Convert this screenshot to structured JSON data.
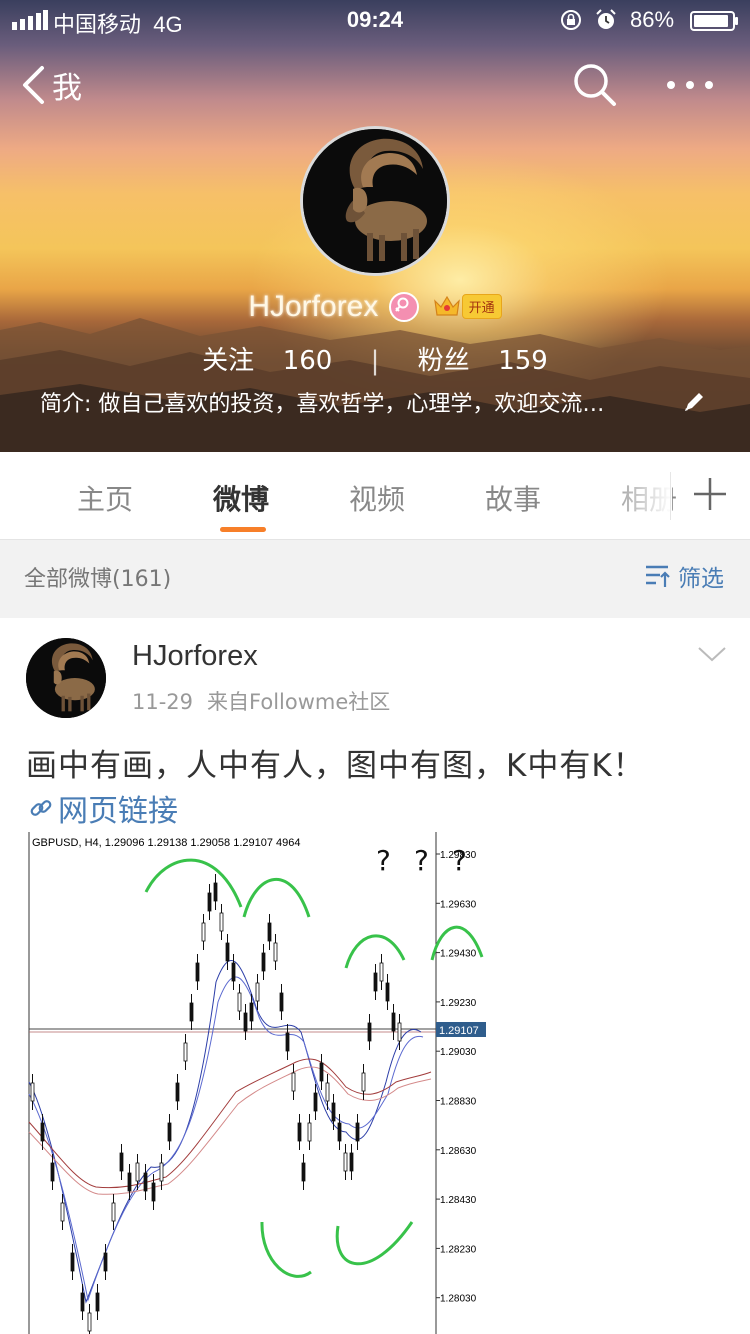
{
  "status_bar": {
    "carrier": "中国移动",
    "network": "4G",
    "time": "09:24",
    "battery": "86%"
  },
  "nav": {
    "back_label": "我",
    "icons": [
      "chevron-left-icon",
      "search-icon",
      "more-icon"
    ]
  },
  "profile": {
    "name": "HJorforex",
    "vip_label": "开通",
    "following_label": "关注",
    "following_count": "160",
    "followers_label": "粉丝",
    "followers_count": "159",
    "bio": "简介: 做自己喜欢的投资，喜欢哲学，心理学，欢迎交流…"
  },
  "tabs": [
    {
      "label": "主页",
      "active": false
    },
    {
      "label": "微博",
      "active": true
    },
    {
      "label": "视频",
      "active": false
    },
    {
      "label": "故事",
      "active": false
    },
    {
      "label": "相册",
      "active": false
    }
  ],
  "accent_color": "#f77f29",
  "link_color": "#4a7db5",
  "feed": {
    "count_label": "全部微博(161)",
    "filter_label": "筛选"
  },
  "post": {
    "author": "HJorforex",
    "date": "11-29",
    "source": "来自Followme社区",
    "text": "画中有画，人中有人，图中有图，K中有K！",
    "link_label": "网页链接",
    "image": {
      "header": "GBPUSD, H4, 1.29096 1.29138 1.29058 1.29107 4964",
      "price_ticks": [
        "1.29830",
        "1.29630",
        "1.29430",
        "1.29230",
        "1.29030",
        "1.28830",
        "1.28630",
        "1.28430",
        "1.28230",
        "1.28030"
      ],
      "current_price": "1.29107",
      "question_marks": [
        "?",
        "?",
        "?"
      ]
    }
  }
}
